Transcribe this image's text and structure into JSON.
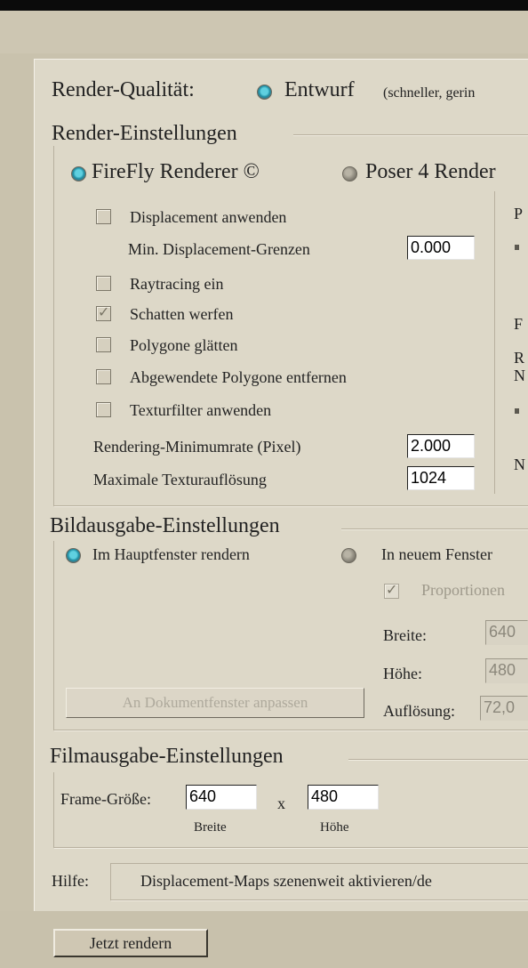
{
  "quality": {
    "label": "Render-Qualität:",
    "option": "Entwurf",
    "option_note": "(schneller, gerin"
  },
  "render_settings": {
    "title": "Render-Einstellungen",
    "renderer_firefly": "FireFly Renderer ©",
    "renderer_poser4": "Poser 4 Render",
    "displacement": "Displacement anwenden",
    "min_displacement_label": "Min. Displacement-Grenzen",
    "min_displacement_value": "0.000",
    "raytracing": "Raytracing ein",
    "cast_shadows": "Schatten werfen",
    "smooth_polygons": "Polygone glätten",
    "remove_backfacing": "Abgewendete Polygone entfernen",
    "texture_filter": "Texturfilter anwenden",
    "min_rate_label": "Rendering-Minimumrate (Pixel)",
    "min_rate_value": "2.000",
    "max_texture_label": "Maximale Texturauflösung",
    "max_texture_value": "1024",
    "right_col_fragments": [
      "P",
      "F",
      "R",
      "N",
      "N"
    ]
  },
  "image_output": {
    "title": "Bildausgabe-Einstellungen",
    "main_window": "Im Hauptfenster rendern",
    "new_window": "In neuem Fenster",
    "proportions": "Proportionen",
    "width_label": "Breite:",
    "width_value": "640",
    "height_label": "Höhe:",
    "height_value": "480",
    "resolution_label": "Auflösung:",
    "resolution_value": "72,0",
    "fit_button": "An Dokumentfenster anpassen"
  },
  "movie_output": {
    "title": "Filmausgabe-Einstellungen",
    "frame_size_label": "Frame-Größe:",
    "width_value": "640",
    "x_label": "x",
    "height_value": "480",
    "width_caption": "Breite",
    "height_caption": "Höhe"
  },
  "help": {
    "label": "Hilfe:",
    "text": "Displacement-Maps szenenweit aktivieren/de"
  },
  "render_now_button": "Jetzt rendern"
}
